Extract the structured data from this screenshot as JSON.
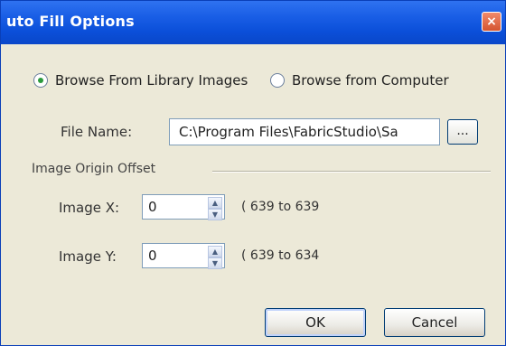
{
  "window": {
    "title": "uto Fill Options",
    "close_label": "×"
  },
  "source": {
    "library_label": "Browse From Library Images",
    "computer_label": "Browse from Computer",
    "selected": "library"
  },
  "file": {
    "label": "File Name:",
    "value": "C:\\Program Files\\FabricStudio\\Sa",
    "browse_label": "..."
  },
  "offset": {
    "group_label": "Image Origin Offset",
    "x": {
      "label": "Image X:",
      "value": "0",
      "range": "( 639 to 639"
    },
    "y": {
      "label": "Image Y:",
      "value": "0",
      "range": "( 639 to 634"
    }
  },
  "buttons": {
    "ok": "OK",
    "cancel": "Cancel"
  }
}
